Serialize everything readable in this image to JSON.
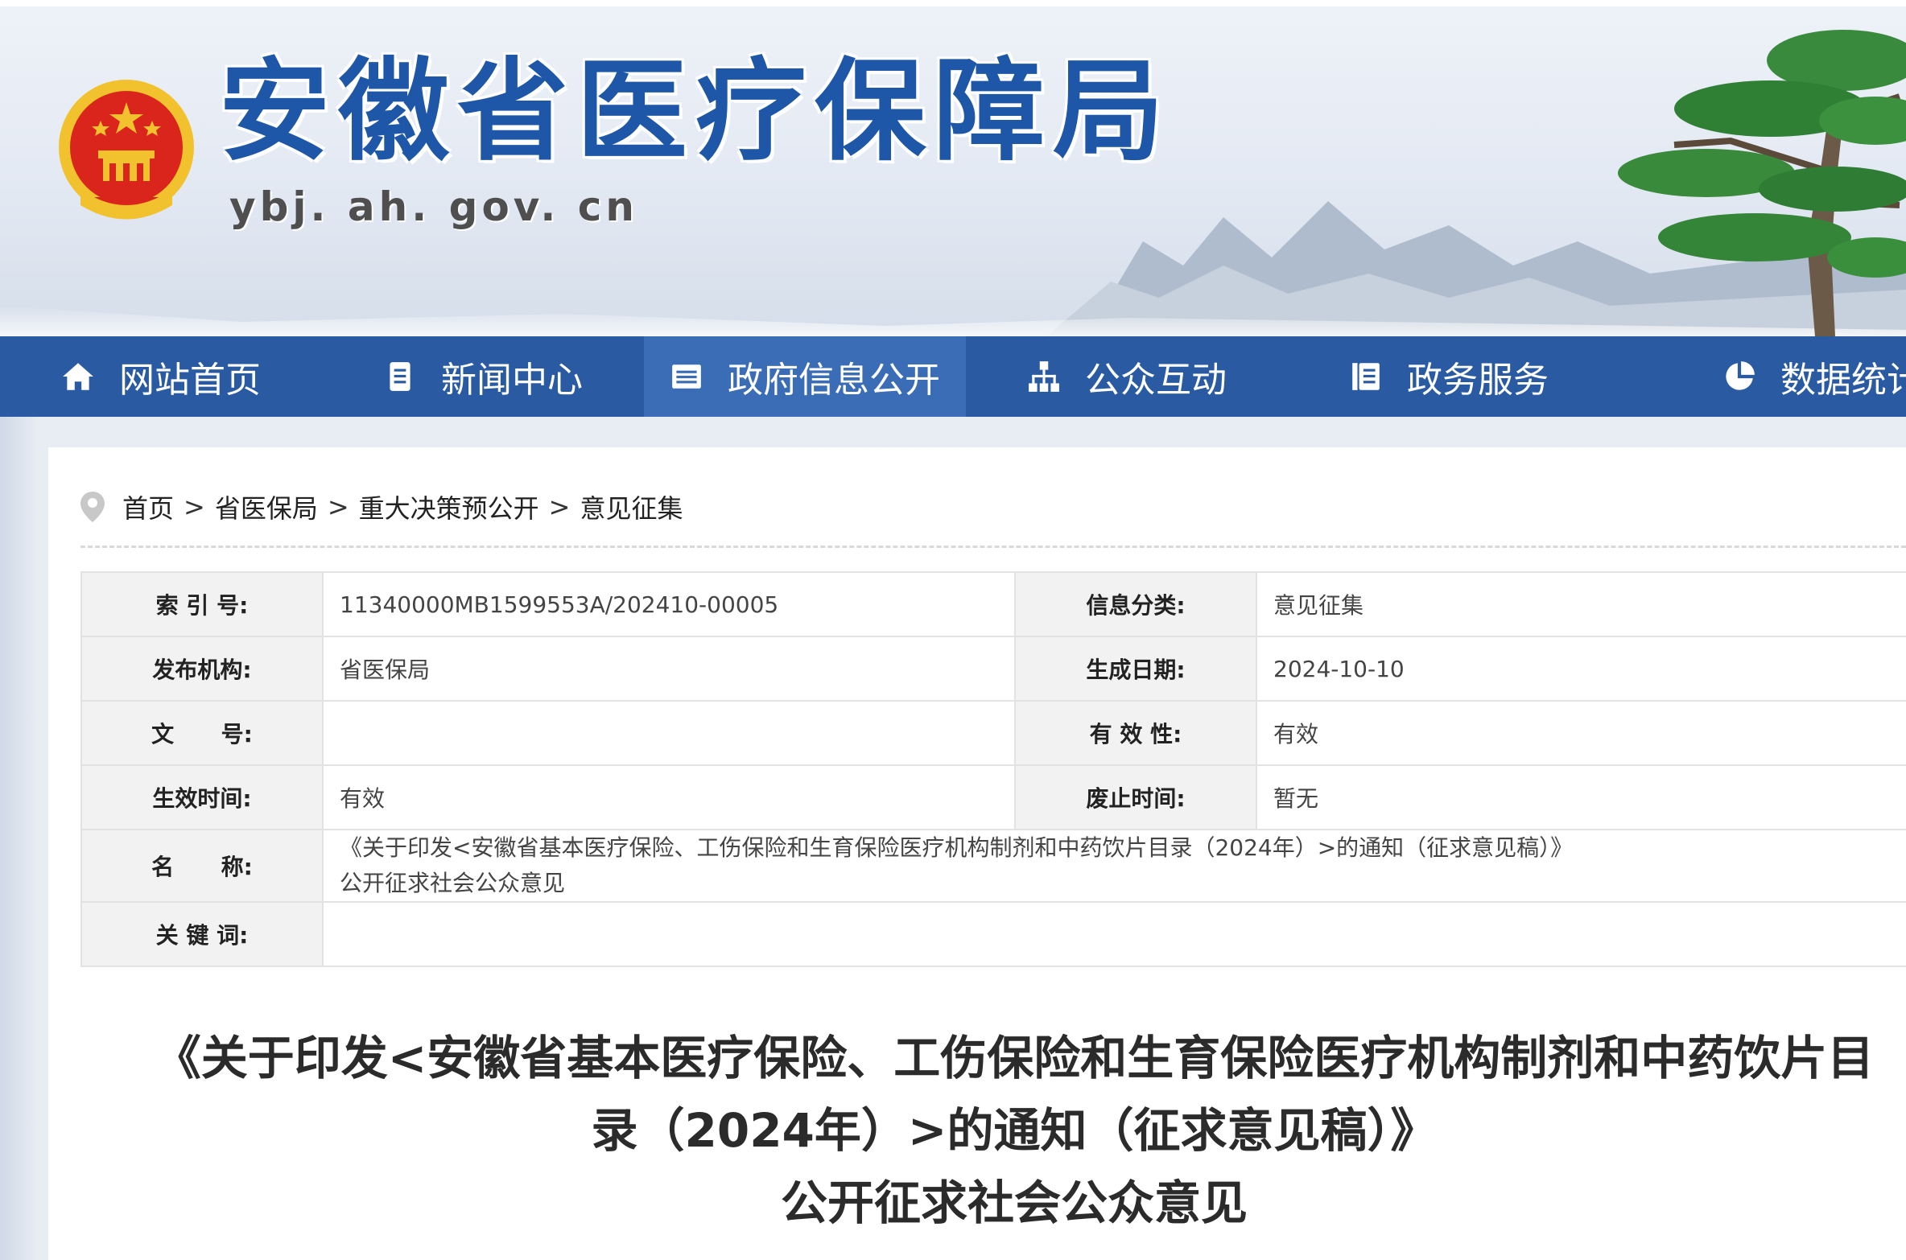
{
  "banner": {
    "site_title": "安徽省医疗保障局",
    "site_domain": "ybj. ah. gov. cn"
  },
  "nav": {
    "items": [
      {
        "label": "网站首页",
        "icon": "home-icon"
      },
      {
        "label": "新闻中心",
        "icon": "document-icon"
      },
      {
        "label": "政府信息公开",
        "icon": "list-icon"
      },
      {
        "label": "公众互动",
        "icon": "org-chart-icon"
      },
      {
        "label": "政务服务",
        "icon": "book-icon"
      },
      {
        "label": "数据统计",
        "icon": "pie-chart-icon"
      }
    ],
    "active_index": 2
  },
  "breadcrumb": {
    "items": [
      "首页",
      "省医保局",
      "重大决策预公开",
      "意见征集"
    ],
    "separator": ">"
  },
  "meta_table": {
    "index_no_label": "索 引 号:",
    "index_no_value": "11340000MB1599553A/202410-00005",
    "category_label": "信息分类:",
    "category_value": "意见征集",
    "publisher_label": "发布机构:",
    "publisher_value": "省医保局",
    "created_label": "生成日期:",
    "created_value": "2024-10-10",
    "doc_no_label": "文      号:",
    "doc_no_value": "",
    "validity_label": "有 效 性:",
    "validity_value": "有效",
    "effective_label": "生效时间:",
    "effective_value": "有效",
    "repeal_label": "废止时间:",
    "repeal_value": "暂无",
    "name_label": "名      称:",
    "name_value_line1": "《关于印发<安徽省基本医疗保险、工伤保险和生育保险医疗机构制剂和中药饮片目录（2024年）>的通知（征求意见稿）》",
    "name_value_line2": "公开征求社会公众意见",
    "keywords_label": "关 键 词:",
    "keywords_value": ""
  },
  "document": {
    "title_line1": "《关于印发<安徽省基本医疗保险、工伤保险和生育保险医疗机构制剂和中药饮片目",
    "title_line2": "录（2024年）>的通知（征求意见稿）》",
    "title_line3": "公开征求社会公众意见"
  },
  "colors": {
    "nav_bg": "#2a5ba2",
    "nav_active": "#3a6db6",
    "title_blue": "#1f57a8",
    "emblem_red": "#d9251c",
    "emblem_gold": "#f2c12e"
  }
}
